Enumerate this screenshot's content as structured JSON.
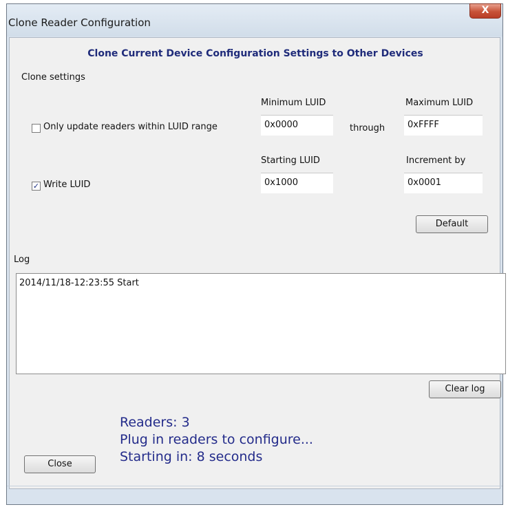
{
  "window": {
    "title": "Clone Reader Configuration",
    "close_glyph": "X"
  },
  "heading": "Clone Current Device Configuration Settings to Other Devices",
  "clone_settings": {
    "group_label": "Clone settings",
    "range": {
      "checkbox_label": "Only update readers within LUID range",
      "checked": false,
      "min_label": "Minimum LUID",
      "min_value": "0x0000",
      "through_label": "through",
      "max_label": "Maximum LUID",
      "max_value": "0xFFFF"
    },
    "write": {
      "checkbox_label": "Write LUID",
      "checked": true,
      "check_glyph": "✓",
      "start_label": "Starting LUID",
      "start_value": "0x1000",
      "increment_label": "Increment by",
      "increment_value": "0x0001"
    },
    "default_button": "Default"
  },
  "log": {
    "label": "Log",
    "lines": [
      "2014/11/18-12:23:55 Start"
    ],
    "clear_button": "Clear log"
  },
  "status": {
    "readers": "Readers: 3",
    "instruction": "Plug in readers to configure...",
    "countdown": "Starting in: 8 seconds"
  },
  "close_button": "Close",
  "icons": {
    "close": "close-icon",
    "checkmark": "checkmark-icon"
  },
  "colors": {
    "heading": "#1f2b7a",
    "status_text": "#232b8a",
    "close_button_red": "#c75137"
  }
}
